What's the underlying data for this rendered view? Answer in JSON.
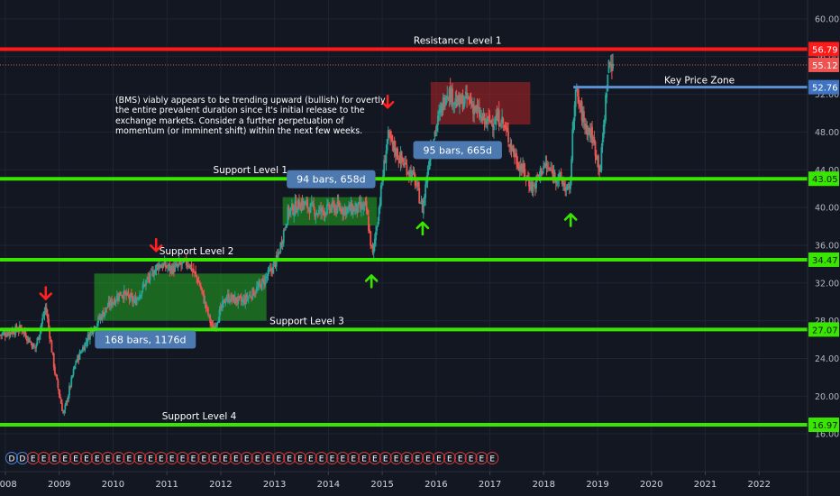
{
  "chart_data": {
    "type": "candlestick",
    "instrument": "BMS",
    "ylim": [
      12.0,
      62.0
    ],
    "xlim": [
      2007.9,
      2022.9
    ],
    "y_ticks": [
      "16.00",
      "20.00",
      "24.00",
      "28.00",
      "32.00",
      "36.00",
      "40.00",
      "44.00",
      "48.00",
      "52.00",
      "56.00",
      "60.00"
    ],
    "x_ticks": [
      "2008",
      "2009",
      "2010",
      "2011",
      "2012",
      "2013",
      "2014",
      "2015",
      "2016",
      "2017",
      "2018",
      "2019",
      "2020",
      "2021",
      "2022"
    ],
    "colors": {
      "background": "#131722",
      "up": "#26a69a",
      "down": "#ef5350",
      "support": "#39e600",
      "resistance": "#ff1a1a",
      "key_zone": "#5b8fd6",
      "label_box": "#4b79b0"
    },
    "horizontal_lines": [
      {
        "label": "Resistance Level 1",
        "price": 56.79,
        "tag": "56.79",
        "color": "#ff1a1a",
        "label_x": 2016.4
      },
      {
        "label": "Support Level 1",
        "price": 43.05,
        "tag": "43.05",
        "color": "#39e600",
        "label_x": 2012.55
      },
      {
        "label": "Support Level 2",
        "price": 34.47,
        "tag": "34.47",
        "color": "#39e600",
        "label_x": 2011.55
      },
      {
        "label": "Support Level 3",
        "price": 27.07,
        "tag": "27.07",
        "color": "#39e600",
        "label_x": 2013.6
      },
      {
        "label": "Support Level 4",
        "price": 16.97,
        "tag": "16.97",
        "color": "#39e600",
        "label_x": 2011.6
      }
    ],
    "key_price_zone": {
      "label": "Key Price Zone",
      "price": 52.76,
      "tag": "52.76",
      "from": 2018.55
    },
    "last_price": {
      "price": 55.12,
      "tag": "55.12"
    },
    "range_boxes": [
      {
        "label": "168 bars, 1176d",
        "x0": 2009.65,
        "x1": 2012.85,
        "y0": 28.0,
        "y1": 33.0,
        "color": "green",
        "label_x": 2010.6,
        "label_y": 26.0
      },
      {
        "label": "94 bars, 658d",
        "x0": 2013.15,
        "x1": 2014.9,
        "y0": 38.1,
        "y1": 41.1,
        "color": "green",
        "label_x": 2014.05,
        "label_y": 43.0
      },
      {
        "label": "95 bars, 665d",
        "x0": 2015.9,
        "x1": 2017.75,
        "y0": 48.8,
        "y1": 53.3,
        "color": "red",
        "label_x": 2016.4,
        "label_y": 46.1
      }
    ],
    "annotation": "(BMS) viably appears to be trending upward (bullish) for overtly the entire prevalent duration since it's initial release to the exchange markets. Consider a further perpetuation of momentum (or imminent shift) within the next few weeks.",
    "arrows_down": [
      {
        "x": 2008.75,
        "y": 30.3
      },
      {
        "x": 2010.8,
        "y": 35.4
      },
      {
        "x": 2015.1,
        "y": 50.6
      }
    ],
    "arrows_up": [
      {
        "x": 2014.8,
        "y": 32.8
      },
      {
        "x": 2015.75,
        "y": 38.4
      },
      {
        "x": 2018.5,
        "y": 39.3
      }
    ],
    "earnings_markers": [
      "D",
      "D",
      "E",
      "E",
      "E",
      "E",
      "E",
      "E",
      "E",
      "E",
      "E",
      "E",
      "E",
      "E",
      "E",
      "E",
      "E",
      "E",
      "E",
      "E",
      "E",
      "E",
      "E",
      "E",
      "E",
      "E",
      "E",
      "E",
      "E",
      "E",
      "E",
      "E",
      "E",
      "E",
      "E",
      "E",
      "E",
      "E",
      "E",
      "E",
      "E",
      "E",
      "E",
      "E",
      "E",
      "E"
    ],
    "price_anchors": [
      [
        2007.9,
        26.5
      ],
      [
        2008.3,
        27.2
      ],
      [
        2008.55,
        25.0
      ],
      [
        2008.75,
        29.5
      ],
      [
        2008.92,
        22.5
      ],
      [
        2009.08,
        18.0
      ],
      [
        2009.3,
        23.5
      ],
      [
        2009.6,
        27.0
      ],
      [
        2009.9,
        29.5
      ],
      [
        2010.15,
        31.0
      ],
      [
        2010.4,
        30.0
      ],
      [
        2010.6,
        32.0
      ],
      [
        2010.85,
        34.0
      ],
      [
        2011.1,
        33.5
      ],
      [
        2011.4,
        34.2
      ],
      [
        2011.6,
        32.0
      ],
      [
        2011.85,
        27.0
      ],
      [
        2012.1,
        30.5
      ],
      [
        2012.4,
        30.0
      ],
      [
        2012.7,
        31.5
      ],
      [
        2012.9,
        33.0
      ],
      [
        2013.05,
        34.5
      ],
      [
        2013.25,
        39.5
      ],
      [
        2013.5,
        40.5
      ],
      [
        2013.8,
        39.5
      ],
      [
        2014.1,
        40.0
      ],
      [
        2014.4,
        39.8
      ],
      [
        2014.7,
        40.0
      ],
      [
        2014.82,
        34.8
      ],
      [
        2014.95,
        40.5
      ],
      [
        2015.1,
        47.5
      ],
      [
        2015.3,
        45.5
      ],
      [
        2015.6,
        43.0
      ],
      [
        2015.75,
        39.8
      ],
      [
        2015.9,
        46.5
      ],
      [
        2016.2,
        52.5
      ],
      [
        2016.4,
        51.0
      ],
      [
        2016.6,
        51.5
      ],
      [
        2016.9,
        49.0
      ],
      [
        2017.2,
        49.5
      ],
      [
        2017.5,
        45.0
      ],
      [
        2017.8,
        42.0
      ],
      [
        2018.0,
        44.5
      ],
      [
        2018.3,
        43.0
      ],
      [
        2018.48,
        41.5
      ],
      [
        2018.58,
        52.5
      ],
      [
        2018.75,
        49.0
      ],
      [
        2018.9,
        47.5
      ],
      [
        2019.05,
        44.0
      ],
      [
        2019.2,
        55.0
      ],
      [
        2019.3,
        55.6
      ]
    ]
  }
}
